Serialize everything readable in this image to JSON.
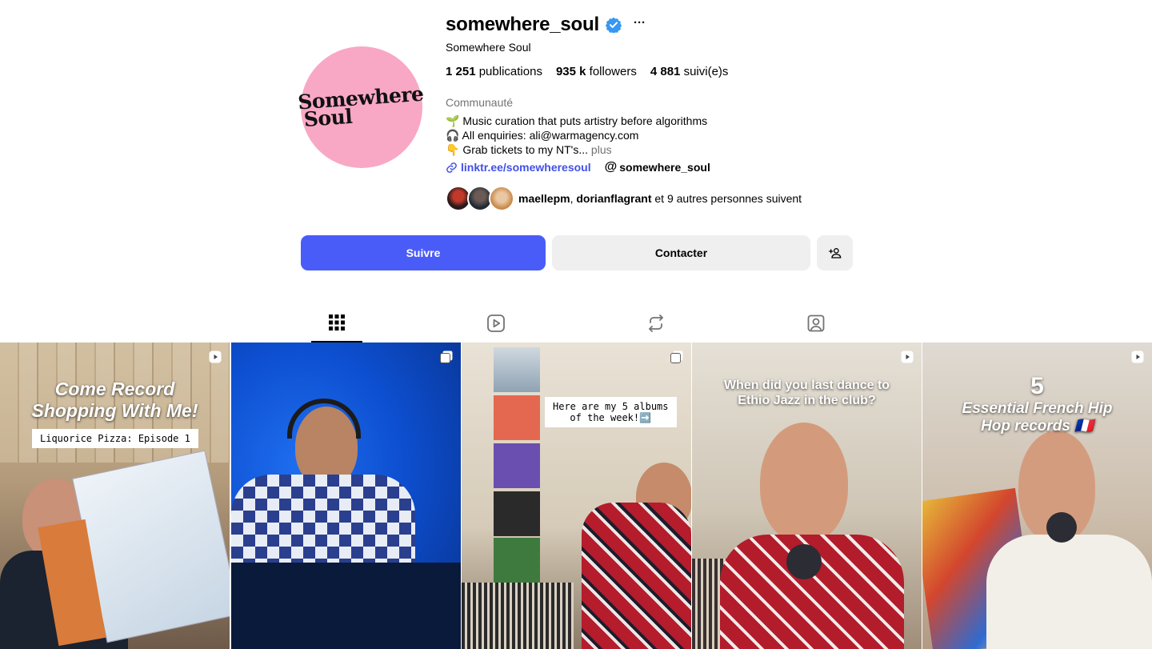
{
  "profile": {
    "username": "somewhere_soul",
    "more_label": "···",
    "full_name": "Somewhere Soul",
    "avatar_text_line1": "Somewhere",
    "avatar_text_line2": "Soul",
    "stats": {
      "posts_count": "1 251",
      "posts_label": "publications",
      "followers_count": "935 k",
      "followers_label": "followers",
      "following_count": "4 881",
      "following_label": "suivi(e)s"
    },
    "category": "Communauté",
    "bio": {
      "line1": "🌱 Music curation that puts artistry before algorithms",
      "line2": "🎧 All enquiries: ali@warmagency.com",
      "line3": "👇 Grab tickets to my NT's...",
      "more": "plus"
    },
    "link_text": "linktr.ee/somewheresoul",
    "threads_glyph": "@",
    "threads_handle": "somewhere_soul",
    "mutuals": {
      "name1": "maellepm",
      "separator": ", ",
      "name2": "dorianflagrant",
      "rest": " et 9 autres personnes suivent"
    }
  },
  "actions": {
    "follow_label": "Suivre",
    "contact_label": "Contacter",
    "add_user_icon": "add-user-icon"
  },
  "tabs": [
    {
      "icon": "grid-icon",
      "active": true
    },
    {
      "icon": "reels-icon",
      "active": false
    },
    {
      "icon": "reposts-icon",
      "active": false
    },
    {
      "icon": "tagged-icon",
      "active": false
    }
  ],
  "posts": [
    {
      "type": "reel",
      "title_line1": "Come Record",
      "title_line2": "Shopping With Me!",
      "label": "Liquorice Pizza: Episode 1"
    },
    {
      "type": "carousel"
    },
    {
      "type": "carousel",
      "label_line1": "Here are my 5 albums",
      "label_line2": "of the week!➡️"
    },
    {
      "type": "reel",
      "title_line1": "When did you last dance to",
      "title_line2": "Ethio Jazz in the club?"
    },
    {
      "type": "reel",
      "number": "5",
      "title_line1": "Essential French Hip",
      "title_line2": "Hop records 🇫🇷"
    }
  ],
  "colors": {
    "follow_button": "#4a5cf8",
    "secondary_button": "#efefef",
    "link": "#4150e8",
    "verified": "#3897f0",
    "avatar_bg": "#f8a8c4",
    "muted_text": "#737373"
  }
}
